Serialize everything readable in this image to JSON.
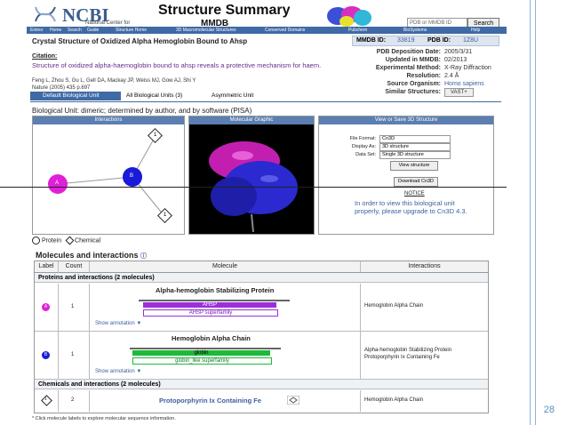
{
  "slide": {
    "page_number": "28"
  },
  "header": {
    "logo_text": "NCBI",
    "logo_sub": "National Center for Biotechnology Information",
    "title": "Structure Summary",
    "subtitle": "MMDB",
    "search_placeholder": "PDB or MMDB ID",
    "search_button": "Search"
  },
  "nav": {
    "items": [
      "Entrez",
      "Home",
      "Search",
      "Guide",
      "Structure Home",
      "3D Macromolecular Structures",
      "Conserved Domains",
      "Pubchem",
      "BioSystems",
      "Help"
    ]
  },
  "record": {
    "title": "Crystal Structure of Oxidized Alpha Hemoglobin Bound to Ahsp",
    "citation_label": "Citation:",
    "citation_title": "Structure of oxidized alpha-haemoglobin bound to ahsp reveals a protective mechanism for haem.",
    "authors": "Feng L, Zhou S, Gu L, Gell DA, Mackay JP, Weiss MJ, Gow AJ, Shi Y",
    "journal": "Nature (2005) 435 p.697"
  },
  "info": {
    "mmdb_label": "MMDB ID:",
    "mmdb_id": "33819",
    "pdb_label": "PDB ID:",
    "pdb_id": "1Z8U",
    "deposition_label": "PDB Deposition Date:",
    "deposition_date": "2005/3/31",
    "updated_label": "Updated in MMDB:",
    "updated_date": "02/2013",
    "method_label": "Experimental Method:",
    "method": "X-Ray Diffraction",
    "resolution_label": "Resolution:",
    "resolution": "2.4 Å",
    "organism_label": "Source Organism:",
    "organism": "Homo sapiens",
    "similar_label": "Similar Structures:",
    "similar_button": "VAST+"
  },
  "tabs": [
    {
      "label": "Default Biological Unit",
      "active": true
    },
    {
      "label": "All Biological Units (3)",
      "active": false
    },
    {
      "label": "Asymmetric Unit",
      "active": false
    }
  ],
  "bio_unit_text": "Biological Unit: dimeric; determined by author, and by software (PISA)",
  "panels": {
    "interactions_title": "Interactions",
    "graphic_title": "Molecular Graphic",
    "download_title": "View or Save 3D Structure",
    "nodes": [
      {
        "label": "A",
        "color": "#e01fd8"
      },
      {
        "label": "B",
        "color": "#1a1ad8"
      },
      {
        "label": "1"
      },
      {
        "label": "1"
      }
    ]
  },
  "download": {
    "format_label": "File Format:",
    "format_value": "Cn3D",
    "display_label": "Display As:",
    "display_value": "3D structure",
    "dataset_label": "Data Set:",
    "dataset_value": "Single 3D structure",
    "view_button": "View structure",
    "download_button": "Download Cn3D",
    "notice_title": "NOTICE",
    "notice_body": "In order to view this biological unit properly, please upgrade to Cn3D 4.3."
  },
  "legend": {
    "protein": "Protein",
    "chemical": "Chemical"
  },
  "molecules": {
    "section_title": "Molecules and interactions",
    "headers": [
      "Label",
      "Count",
      "Molecule",
      "Interactions"
    ],
    "proteins_header": "Proteins and interactions (2 molecules)",
    "chemicals_header": "Chemicals and interactions (2 molecules)",
    "show_annotation": "Show annotation ▼",
    "rows": [
      {
        "label": "A",
        "count": "1",
        "name": "Alpha-hemoglobin Stabilizing Protein",
        "bar1": "AHSP",
        "bar2": "AHSP superfamily",
        "bar_color": "#9b2fd8",
        "interactions": "Hemoglobin Alpha Chain"
      },
      {
        "label": "B",
        "count": "1",
        "name": "Hemoglobin Alpha Chain",
        "bar1": "globin",
        "bar2": "globin_like superfamily",
        "bar_color": "#1fb83a",
        "interactions_1": "Alpha-hemoglobin Stabilizing Protein",
        "interactions_2": "Protoporphyrin Ix Containing Fe"
      }
    ],
    "chem_row": {
      "label": "1",
      "count": "2",
      "name": "Protoporphyrin Ix Containing Fe",
      "interactions": "Hemoglobin Alpha Chain"
    }
  },
  "footnote": "* Click molecule labels to explore molecular sequence information."
}
